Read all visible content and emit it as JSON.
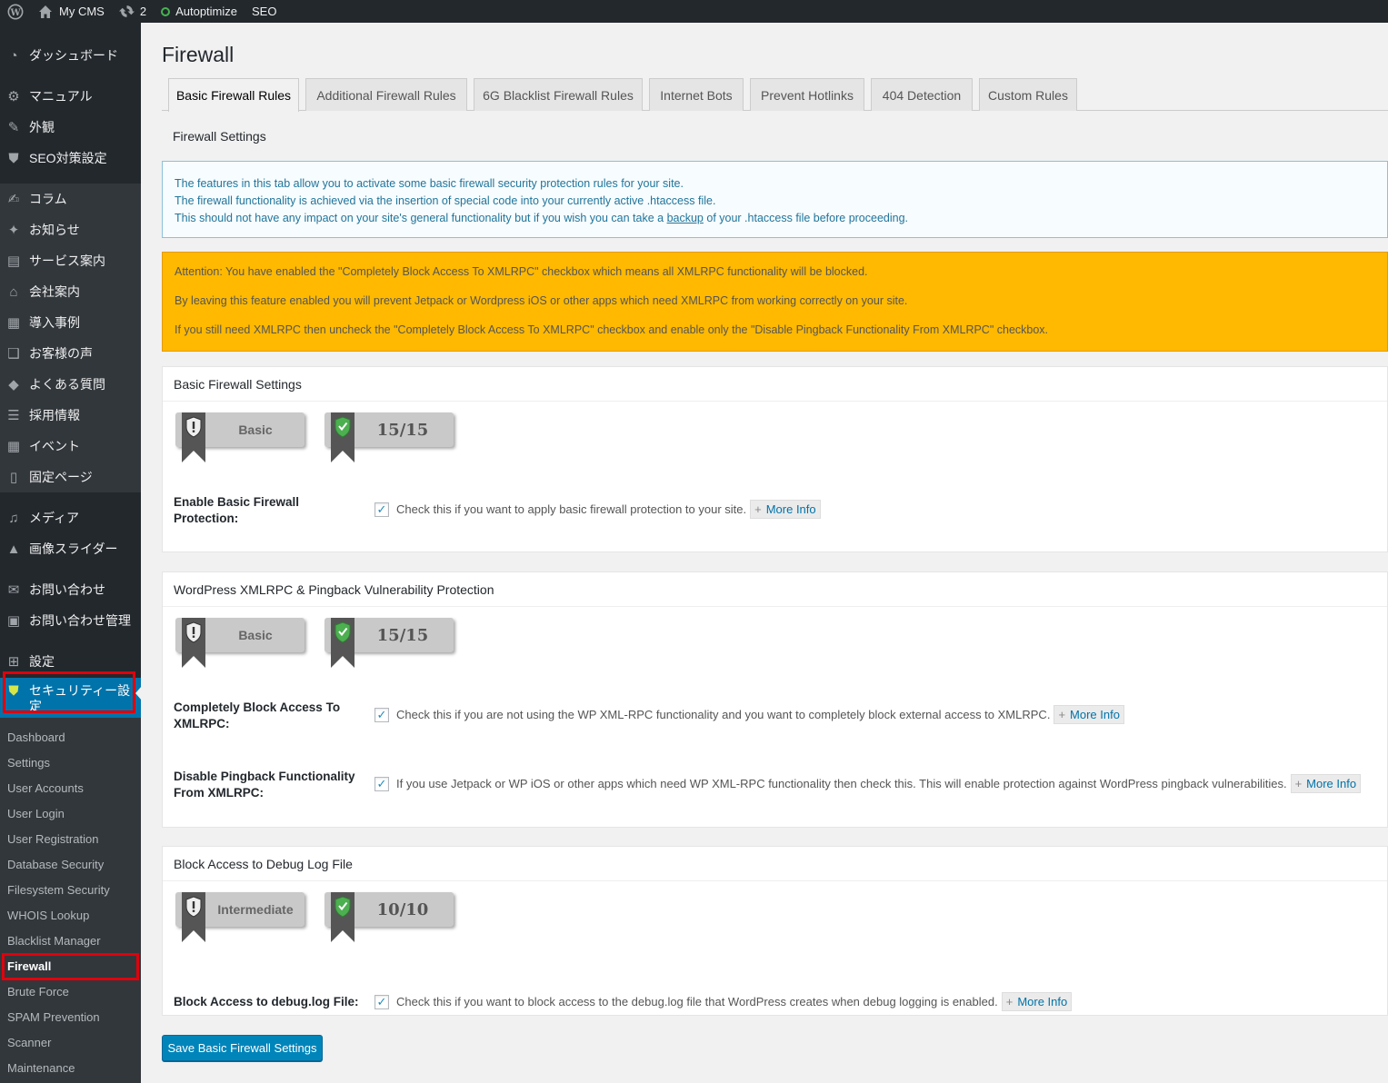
{
  "adminbar": {
    "wp_logo": "wordpress-icon",
    "site_name": "My CMS",
    "updates_count": "2",
    "autoptimize": "Autoptimize",
    "seo": "SEO"
  },
  "sidebar": {
    "items": [
      {
        "label": "ダッシュボード",
        "icon": "dashboard-icon"
      },
      {
        "label": "マニュアル",
        "icon": "gear-icon"
      },
      {
        "label": "外観",
        "icon": "brush-icon"
      },
      {
        "label": "SEO対策設定",
        "icon": "shield-icon"
      },
      {
        "label": "コラム",
        "icon": "edit-icon"
      },
      {
        "label": "お知らせ",
        "icon": "pin-icon"
      },
      {
        "label": "サービス案内",
        "icon": "book-icon"
      },
      {
        "label": "会社案内",
        "icon": "store-icon"
      },
      {
        "label": "導入事例",
        "icon": "images-icon"
      },
      {
        "label": "お客様の声",
        "icon": "comments-icon"
      },
      {
        "label": "よくある質問",
        "icon": "tag-icon"
      },
      {
        "label": "採用情報",
        "icon": "list-icon"
      },
      {
        "label": "イベント",
        "icon": "calendar-icon"
      },
      {
        "label": "固定ページ",
        "icon": "page-icon"
      },
      {
        "label": "メディア",
        "icon": "media-icon"
      },
      {
        "label": "画像スライダー",
        "icon": "slider-icon"
      },
      {
        "label": "お問い合わせ",
        "icon": "mail-icon"
      },
      {
        "label": "お問い合わせ管理",
        "icon": "inbox-icon"
      },
      {
        "label": "設定",
        "icon": "settings-icon"
      },
      {
        "label": "セキュリティー設定",
        "icon": "security-shield-icon"
      }
    ],
    "submenu": [
      "Dashboard",
      "Settings",
      "User Accounts",
      "User Login",
      "User Registration",
      "Database Security",
      "Filesystem Security",
      "WHOIS Lookup",
      "Blacklist Manager",
      "Firewall",
      "Brute Force",
      "SPAM Prevention",
      "Scanner",
      "Maintenance"
    ],
    "accent_color": "#0073aa",
    "highlight_color": "#e0000c"
  },
  "main": {
    "title": "Firewall",
    "tabs": [
      "Basic Firewall Rules",
      "Additional Firewall Rules",
      "6G Blacklist Firewall Rules",
      "Internet Bots",
      "Prevent Hotlinks",
      "404 Detection",
      "Custom Rules"
    ],
    "section_title": "Firewall Settings",
    "info": {
      "line1": "The features in this tab allow you to activate some basic firewall security protection rules for your site.",
      "line2": "The firewall functionality is achieved via the insertion of special code into your currently active .htaccess file.",
      "line3_pre": "This should not have any impact on your site's general functionality but if you wish you can take a ",
      "line3_link": "backup",
      "line3_post": " of your .htaccess file before proceeding."
    },
    "warning": {
      "line1": "Attention: You have enabled the \"Completely Block Access To XMLRPC\" checkbox which means all XMLRPC functionality will be blocked.",
      "line2": "By leaving this feature enabled you will prevent Jetpack or Wordpress iOS or other apps which need XMLRPC from working correctly on your site.",
      "line3": "If you still need XMLRPC then uncheck the \"Completely Block Access To XMLRPC\" checkbox and enable only the \"Disable Pingback Functionality From XMLRPC\" checkbox.",
      "color": "#ffb900"
    },
    "boxes": [
      {
        "title": "Basic Firewall Settings",
        "level": "Basic",
        "score": "15/15",
        "fields": [
          {
            "label": "Enable Basic Firewall Protection:",
            "checked": true,
            "desc": "Check this if you want to apply basic firewall protection to your site.",
            "more": "More Info"
          }
        ]
      },
      {
        "title": "WordPress XMLRPC & Pingback Vulnerability Protection",
        "level": "Basic",
        "score": "15/15",
        "fields": [
          {
            "label": "Completely Block Access To XMLRPC:",
            "checked": true,
            "desc": "Check this if you are not using the WP XML-RPC functionality and you want to completely block external access to XMLRPC.",
            "more": "More Info"
          },
          {
            "label": "Disable Pingback Functionality From XMLRPC:",
            "checked": true,
            "desc": "If you use Jetpack or WP iOS or other apps which need WP XML-RPC functionality then check this. This will enable protection against WordPress pingback vulnerabilities.",
            "more": "More Info"
          }
        ]
      },
      {
        "title": "Block Access to Debug Log File",
        "level": "Intermediate",
        "score": "10/10",
        "fields": [
          {
            "label": "Block Access to debug.log File:",
            "checked": true,
            "desc": "Check this if you want to block access to the debug.log file that WordPress creates when debug logging is enabled.",
            "more": "More Info"
          }
        ]
      }
    ],
    "save_label": "Save Basic Firewall Settings",
    "checkmark": "✓",
    "plus": "+"
  }
}
